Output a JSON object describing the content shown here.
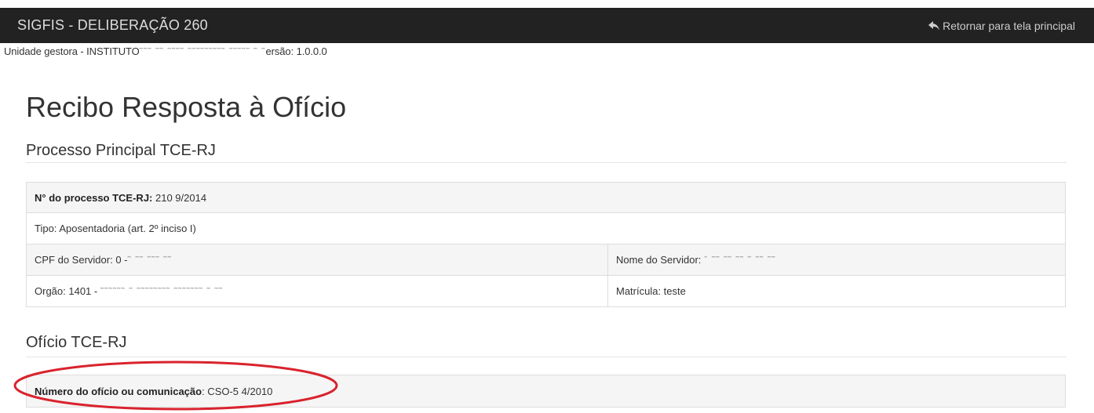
{
  "header": {
    "brand": "SIGFIS - DELIBERAÇÃO 260",
    "return_label": "Retornar para tela principal"
  },
  "unit_line": {
    "prefix": "Unidade gestora - INSTITUTO",
    "version": "ersão: 1.0.0.0"
  },
  "page": {
    "title": "Recibo Resposta à Ofício"
  },
  "processo": {
    "section_title": "Processo Principal TCE-RJ",
    "numero_label": "N° do processo TCE-RJ:",
    "numero_value": " 210  9/2014",
    "tipo": "Tipo: Aposentadoria (art. 2º inciso I)",
    "cpf_label": "CPF do Servidor: ",
    "cpf_value": "0   -",
    "nome_label": "Nome do Servidor: ",
    "nome_value": "",
    "orgao_label": "Orgão: 1401 - ",
    "orgao_value": "",
    "matricula": "Matrícula: teste"
  },
  "oficio": {
    "section_title": "Ofício TCE-RJ",
    "numero_label": "Número do ofício ou comunicação",
    "numero_value": ": CSO-5  4/2010"
  },
  "colors": {
    "navbar": "#222222",
    "highlight_ellipse": "#d9232d"
  }
}
